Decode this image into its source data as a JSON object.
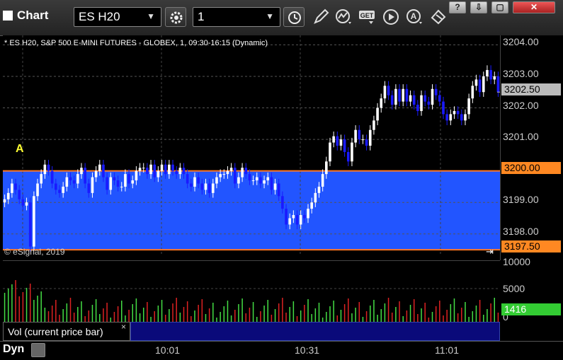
{
  "app": {
    "title": "Chart"
  },
  "toolbar": {
    "symbol_value": "ES H20",
    "interval_value": "1",
    "buttons": [
      "gear-icon",
      "clock-icon",
      "pencil-icon",
      "trend-icon",
      "get-icon",
      "play-icon",
      "a-icon",
      "cursor-icon"
    ]
  },
  "window_controls": {
    "labels": [
      "?",
      "⇩",
      "▢",
      "✕"
    ]
  },
  "chart": {
    "info": "* ES H20, S&P 500 E-MINI FUTURES - GLOBEX, 1, 09:30-16:15 (Dynamic)",
    "copyright": "© eSignal, 2019",
    "marker": "A",
    "price_axis": [
      "3204.00",
      "3203.00",
      "3202.00",
      "3201.00",
      "3199.00",
      "3198.00"
    ],
    "price_tags": {
      "last": "3202.50",
      "upper_level": "3200.00",
      "lower_level": "3197.50"
    },
    "colors": {
      "up": "#ffffff",
      "down": "#1a1aff",
      "band": "#2255ff",
      "level_line": "#ff7722",
      "volume_up": "#44dd44",
      "volume_down": "#dd2222",
      "last_volume": "#33cc33"
    }
  },
  "volume": {
    "label": "Vol (current price bar)",
    "close_icon": "×",
    "axis": [
      "10000",
      "5000",
      "0"
    ],
    "last_value": "1416"
  },
  "timebar": {
    "mode": "Dyn",
    "times": [
      "10:01",
      "10:31",
      "11:01"
    ]
  },
  "chart_data": {
    "type": "candlestick",
    "title": "ES H20, S&P 500 E-MINI FUTURES - GLOBEX, 1, 09:30-16:15 (Dynamic)",
    "ylim": [
      3197.3,
      3204.3
    ],
    "x_ticks": [
      "10:01",
      "10:31",
      "11:01"
    ],
    "levels": [
      3200.0,
      3197.5
    ],
    "last": 3202.5,
    "close": [
      3199.1,
      3199.3,
      3199.6,
      3199.4,
      3199.1,
      3198.9,
      3199.0,
      3197.6,
      3199.2,
      3199.6,
      3199.9,
      3200.2,
      3200.0,
      3199.6,
      3199.4,
      3199.3,
      3199.5,
      3199.8,
      3199.7,
      3199.6,
      3199.9,
      3200.1,
      3199.6,
      3199.3,
      3199.8,
      3200.0,
      3200.2,
      3199.8,
      3199.4,
      3199.8,
      3199.7,
      3199.5,
      3199.5,
      3199.9,
      3199.6,
      3199.7,
      3200.0,
      3200.1,
      3200.1,
      3199.9,
      3200.2,
      3199.8,
      3200.0,
      3200.2,
      3199.9,
      3200.2,
      3200.0,
      3199.9,
      3200.1,
      3199.9,
      3199.6,
      3199.5,
      3199.8,
      3199.6,
      3199.4,
      3199.6,
      3199.3,
      3199.6,
      3199.8,
      3199.9,
      3199.9,
      3200.0,
      3200.1,
      3199.6,
      3199.8,
      3200.1,
      3199.9,
      3199.7,
      3199.7,
      3199.8,
      3199.6,
      3199.7,
      3199.8,
      3199.4,
      3199.6,
      3199.2,
      3198.8,
      3198.3,
      3198.5,
      3198.6,
      3198.3,
      3198.6,
      3198.5,
      3198.8,
      3199.0,
      3199.3,
      3199.5,
      3199.9,
      3200.3,
      3200.9,
      3201.1,
      3200.8,
      3201.0,
      3200.6,
      3200.3,
      3200.9,
      3201.3,
      3201.0,
      3201.0,
      3200.8,
      3201.3,
      3201.6,
      3202.0,
      3202.3,
      3202.7,
      3202.4,
      3202.1,
      3202.6,
      3202.2,
      3202.6,
      3202.2,
      3202.4,
      3202.1,
      3201.9,
      3202.4,
      3202.2,
      3202.1,
      3202.6,
      3202.4,
      3202.2,
      3201.8,
      3201.6,
      3201.8,
      3201.9,
      3201.8,
      3201.6,
      3201.8,
      3202.3,
      3202.7,
      3202.9,
      3202.5,
      3203.0,
      3203.2,
      3202.9,
      3203.0,
      3202.5
    ]
  }
}
